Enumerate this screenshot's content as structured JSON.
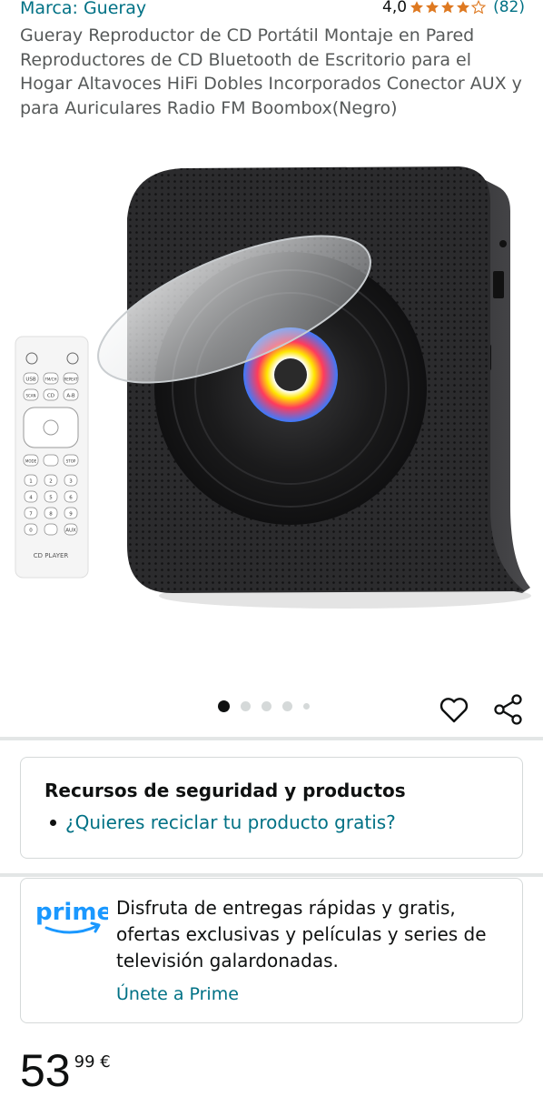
{
  "header": {
    "brand": "Marca: Gueray",
    "rating": "4,0",
    "stars_filled": 4,
    "stars_total": 5,
    "review_count": "(82)"
  },
  "product": {
    "title": "Gueray Reproductor de CD Portátil Montaje en Pared Reproductores de CD Bluetooth de Escritorio para el Hogar Altavoces HiFi Dobles Incorporados Conector AUX y para Auriculares Radio FM Boombox(Negro)"
  },
  "image": {
    "remote_label": "CD PLAYER",
    "remote_keys": [
      "USB",
      "FM/CH",
      "REPEAT",
      "SCAN",
      "CD",
      "A-B",
      "MODE",
      "STOP",
      "1",
      "2",
      "3",
      "4",
      "5",
      "6",
      "7",
      "8",
      "9",
      "0",
      "AUX"
    ],
    "carousel_total": 5,
    "carousel_index": 1
  },
  "safety": {
    "title": "Recursos de seguridad y productos",
    "link": "¿Quieres reciclar tu producto gratis?"
  },
  "prime": {
    "logo_text": "prime",
    "description": "Disfruta de entregas rápidas y gratis, ofertas exclusivas y películas y series de televisión galardonadas.",
    "cta": "Únete a Prime"
  },
  "price": {
    "whole": "53",
    "fraction": "99 €"
  },
  "colors": {
    "link": "#007185",
    "star": "#de7921",
    "prime_blue": "#1a98ff",
    "text": "#0f1111",
    "secondary_text": "#565959"
  }
}
